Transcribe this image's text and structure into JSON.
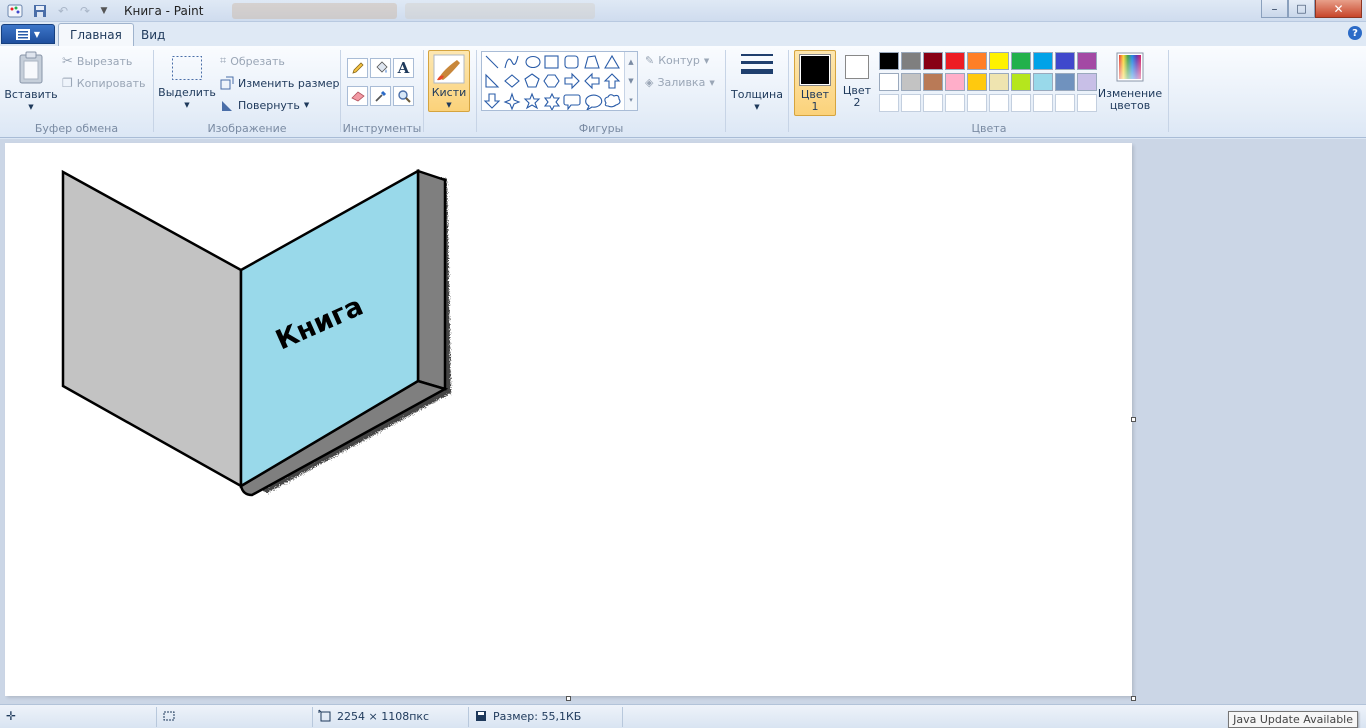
{
  "window": {
    "title": "Книга - Paint",
    "minimize": "–",
    "maximize": "□",
    "close": "✕"
  },
  "tabs": [
    {
      "label": "Главная",
      "active": true
    },
    {
      "label": "Вид",
      "active": false
    }
  ],
  "help": "?",
  "ribbon": {
    "clipboard": {
      "paste": "Вставить",
      "cut": "Вырезать",
      "copy": "Копировать",
      "label": "Буфер обмена"
    },
    "image": {
      "select": "Выделить",
      "crop": "Обрезать",
      "resize": "Изменить размер",
      "rotate": "Повернуть",
      "label": "Изображение"
    },
    "tools": {
      "label": "Инструменты",
      "items": [
        "pencil-icon",
        "fill-icon",
        "text-icon",
        "eraser-icon",
        "color-picker-icon",
        "magnifier-icon"
      ]
    },
    "brushes": {
      "label": "Кисти"
    },
    "shapes": {
      "outline": "Контур",
      "fill": "Заливка",
      "label": "Фигуры",
      "items": [
        "line",
        "curve",
        "oval",
        "rectangle",
        "rounded-rectangle",
        "polygon",
        "triangle",
        "right-triangle",
        "diamond",
        "pentagon",
        "hexagon",
        "right-arrow",
        "left-arrow",
        "up-arrow",
        "down-arrow",
        "four-point-star",
        "five-point-star",
        "six-point-star",
        "rounded-callout",
        "oval-callout",
        "cloud-callout"
      ]
    },
    "size": {
      "label": "Толщина"
    },
    "color1": {
      "label1": "Цвет",
      "label2": "1",
      "value": "#000000"
    },
    "color2": {
      "label1": "Цвет",
      "label2": "2",
      "value": "#ffffff"
    },
    "colors": {
      "label": "Цвета",
      "row1": [
        "#000000",
        "#7f7f7f",
        "#880015",
        "#ed1c24",
        "#ff7f27",
        "#fff200",
        "#22b14c",
        "#00a2e8",
        "#3f48cc",
        "#a349a4"
      ],
      "row2": [
        "#ffffff",
        "#c3c3c3",
        "#b97a57",
        "#ffaec9",
        "#ffc90e",
        "#efe4b0",
        "#b5e61d",
        "#99d9ea",
        "#7092be",
        "#c8bfe7"
      ],
      "row3": [
        "#ffffff",
        "#ffffff",
        "#ffffff",
        "#ffffff",
        "#ffffff",
        "#ffffff",
        "#ffffff",
        "#ffffff",
        "#ffffff",
        "#ffffff"
      ]
    },
    "edit_colors": {
      "label1": "Изменение",
      "label2": "цветов"
    }
  },
  "canvas": {
    "book_text": "Книга",
    "left_page_color": "#c3c3c3",
    "right_page_color": "#99d9ea",
    "spine_color": "#7f7f7f"
  },
  "status": {
    "image_size": "2254 × 1108пкс",
    "file_size": "Размер: 55,1КБ",
    "tooltip": "Java Update Available"
  }
}
